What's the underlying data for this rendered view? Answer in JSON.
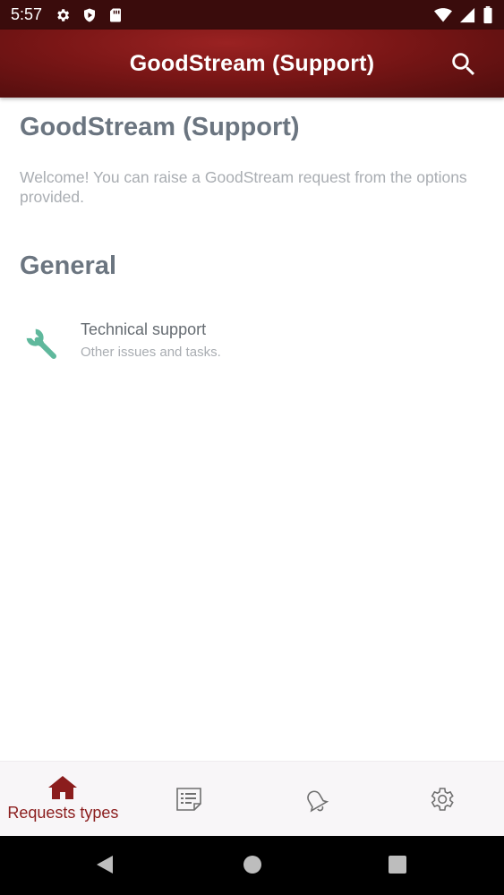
{
  "status_bar": {
    "time": "5:57",
    "left_icons": [
      "gear-icon",
      "play-protect-icon",
      "sd-card-icon"
    ],
    "right_icons": [
      "wifi-icon",
      "signal-icon",
      "battery-icon"
    ]
  },
  "app_bar": {
    "title": "GoodStream (Support)",
    "search_icon": "search-icon",
    "accent_color": "#7a1616"
  },
  "main": {
    "page_title": "GoodStream (Support)",
    "welcome_text": "Welcome! You can raise a GoodStream request from the options provided.",
    "sections": [
      {
        "title": "General",
        "items": [
          {
            "icon": "wrench-icon",
            "title": "Technical support",
            "subtitle": "Other issues and tasks."
          }
        ]
      }
    ]
  },
  "bottom_nav": {
    "active_color": "#8b1d1d",
    "items": [
      {
        "icon": "home-icon",
        "label": "Requests types",
        "active": true
      },
      {
        "icon": "requests-list-icon",
        "label": "",
        "active": false
      },
      {
        "icon": "notifications-bell-icon",
        "label": "",
        "active": false
      },
      {
        "icon": "settings-gear-icon",
        "label": "",
        "active": false
      }
    ]
  },
  "system_nav": [
    "back-icon",
    "home-circle-icon",
    "recents-icon"
  ]
}
